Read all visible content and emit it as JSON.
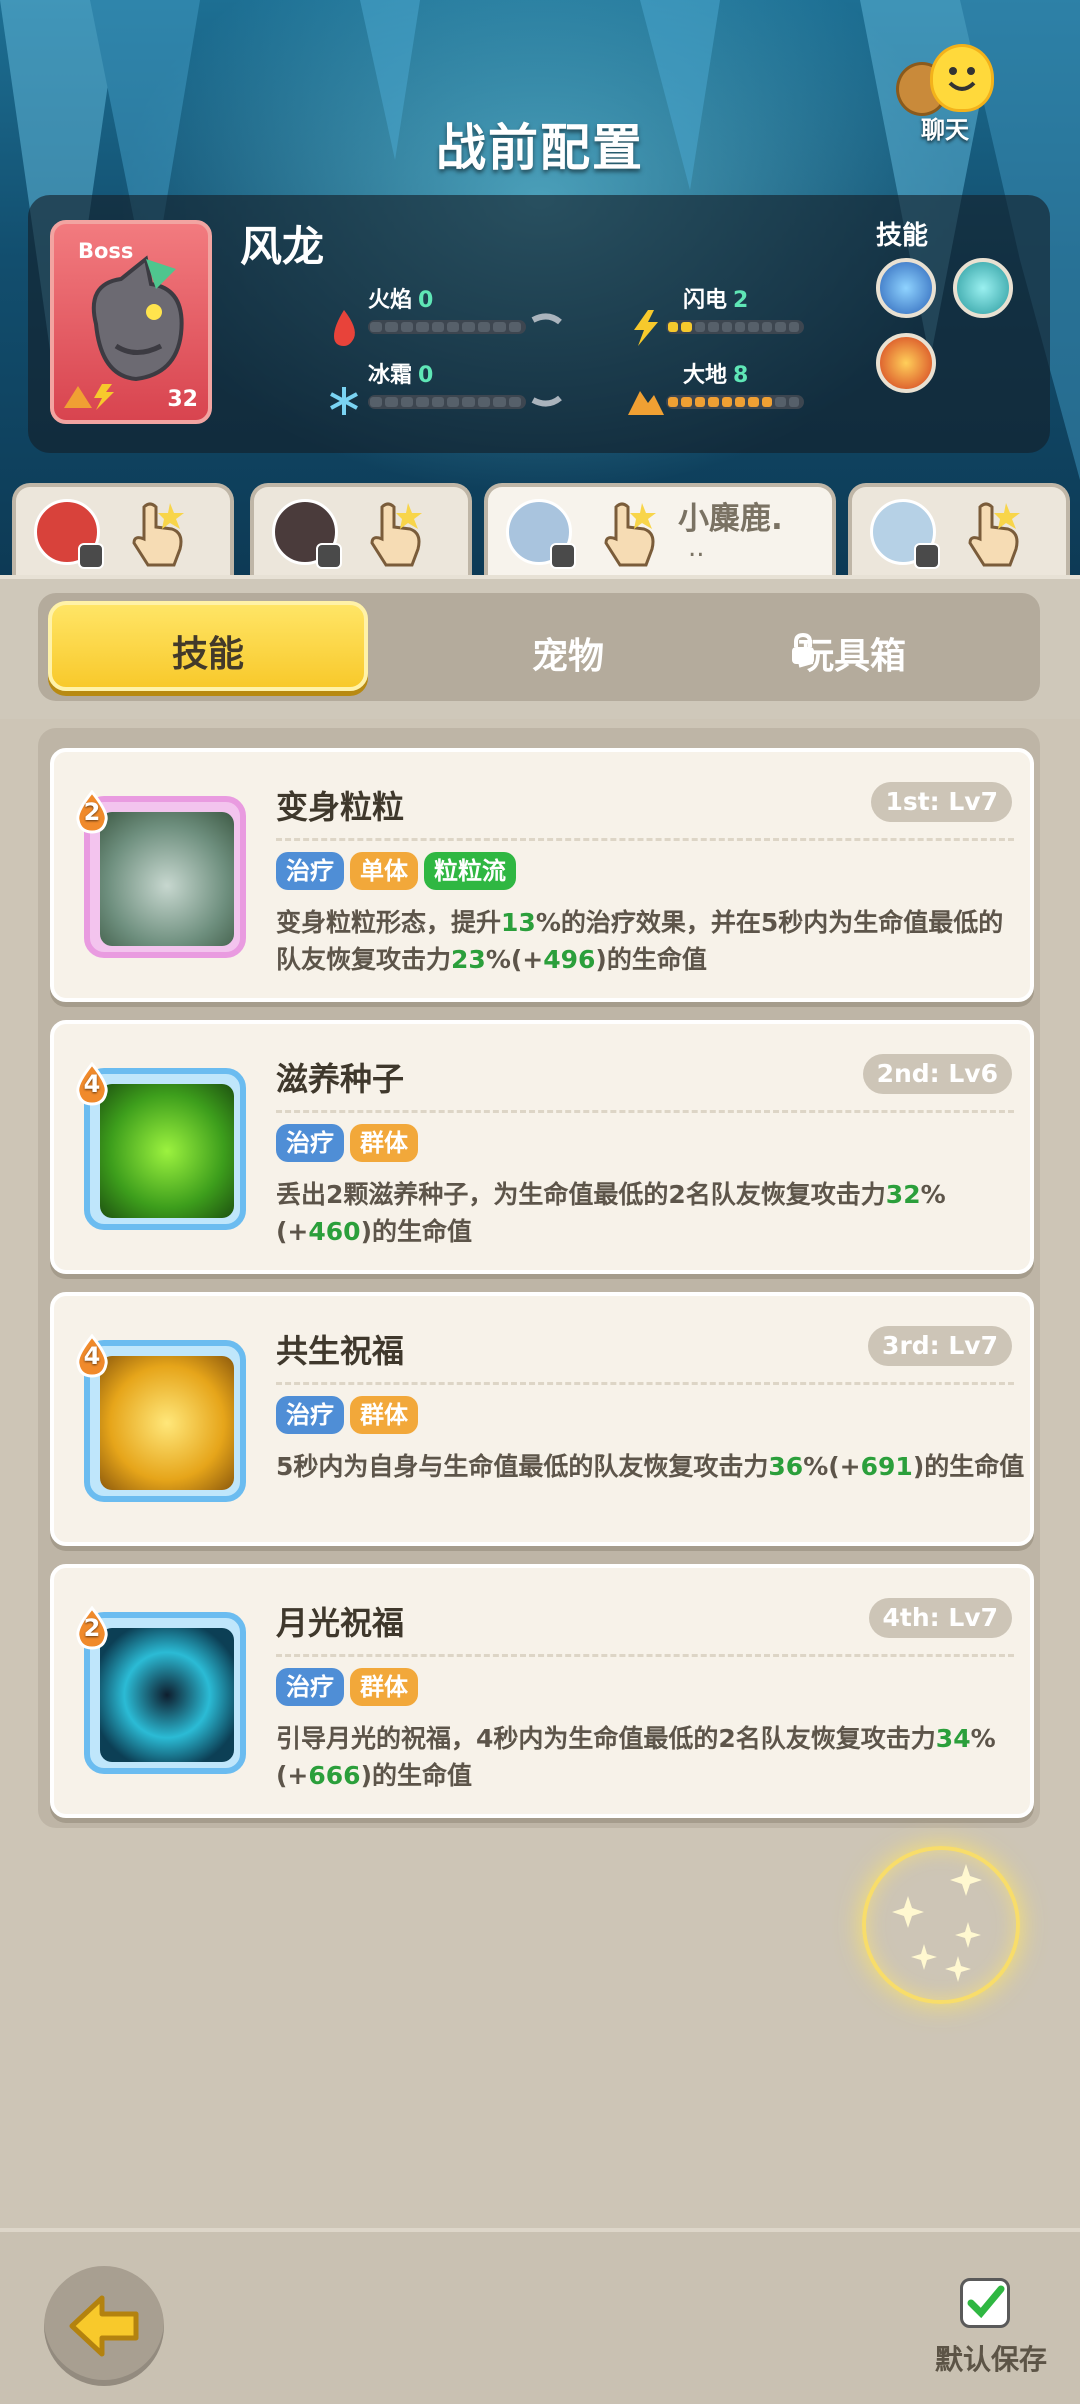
{
  "header": {
    "title": "战前配置",
    "chat_label": "聊天"
  },
  "boss": {
    "tag": "Boss",
    "name": "风龙",
    "level": "32",
    "elements": [
      {
        "name": "火焰",
        "value": "0",
        "filled": 0,
        "color": "#e8433a"
      },
      {
        "name": "闪电",
        "value": "2",
        "filled": 2,
        "color": "#f7c92c"
      },
      {
        "name": "冰霜",
        "value": "0",
        "filled": 0,
        "color": "#7ad3f2"
      },
      {
        "name": "大地",
        "value": "8",
        "filled": 8,
        "color": "#f0a033"
      }
    ],
    "skills_label": "技能"
  },
  "heroes": [
    {
      "avatar_color": "#d8423b",
      "name": "",
      "active": false
    },
    {
      "avatar_color": "#4a3b3b",
      "name": "",
      "active": false
    },
    {
      "avatar_color": "#a9c4de",
      "name": "小麋鹿.",
      "name2": "..",
      "active": true
    },
    {
      "avatar_color": "#b6d1e6",
      "name": "",
      "active": false
    }
  ],
  "tabs": {
    "skill": "技能",
    "pet": "宠物",
    "toybox": "玩具箱"
  },
  "skills": [
    {
      "cost": "2",
      "name": "变身粒粒",
      "level": "1st: Lv7",
      "frame": "pink",
      "tags": [
        {
          "text": "治疗",
          "color": "blue"
        },
        {
          "text": "单体",
          "color": "orange"
        },
        {
          "text": "粒粒流",
          "color": "green"
        }
      ],
      "desc": [
        {
          "t": "变身粒粒形态，提升"
        },
        {
          "t": "13",
          "hl": true
        },
        {
          "t": "%的治疗效果，并在5秒内为生命值最低的队友恢复攻击力"
        },
        {
          "t": "23",
          "hl": true
        },
        {
          "t": "%(+"
        },
        {
          "t": "496",
          "hl": true
        },
        {
          "t": ")的生命值"
        }
      ]
    },
    {
      "cost": "4",
      "name": "滋养种子",
      "level": "2nd: Lv6",
      "frame": "blue",
      "tags": [
        {
          "text": "治疗",
          "color": "blue"
        },
        {
          "text": "群体",
          "color": "orange"
        }
      ],
      "desc": [
        {
          "t": "丢出2颗滋养种子，为生命值最低的2名队友恢复攻击力"
        },
        {
          "t": "32",
          "hl": true
        },
        {
          "t": "%(+"
        },
        {
          "t": "460",
          "hl": true
        },
        {
          "t": ")的生命值"
        }
      ]
    },
    {
      "cost": "4",
      "name": "共生祝福",
      "level": "3rd: Lv7",
      "frame": "blue",
      "tags": [
        {
          "text": "治疗",
          "color": "blue"
        },
        {
          "text": "群体",
          "color": "orange"
        }
      ],
      "desc": [
        {
          "t": "5秒内为自身与生命值最低的队友恢复攻击力"
        },
        {
          "t": "36",
          "hl": true
        },
        {
          "t": "%(+"
        },
        {
          "t": "691",
          "hl": true
        },
        {
          "t": ")的生命值"
        }
      ]
    },
    {
      "cost": "2",
      "name": "月光祝福",
      "level": "4th: Lv7",
      "frame": "blue",
      "tags": [
        {
          "text": "治疗",
          "color": "blue"
        },
        {
          "text": "群体",
          "color": "orange"
        }
      ],
      "desc": [
        {
          "t": "引导月光的祝福，4秒内为生命值最低的2名队友恢复攻击力"
        },
        {
          "t": "34",
          "hl": true
        },
        {
          "t": "%(+"
        },
        {
          "t": "666",
          "hl": true
        },
        {
          "t": ")的生命值"
        }
      ]
    }
  ],
  "footer": {
    "save_label": "默认保存",
    "save_checked": true
  }
}
